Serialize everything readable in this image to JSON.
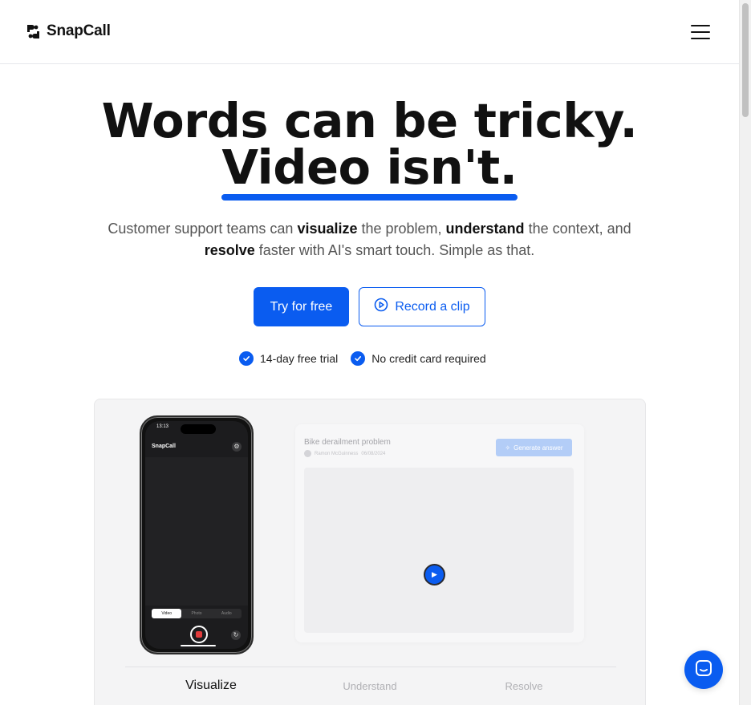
{
  "brand": {
    "name": "SnapCall",
    "accent": "#0a5cf0"
  },
  "hero": {
    "title_line1": "Words can be tricky.",
    "title_line2": "Video isn't.",
    "subtitle": {
      "p1": "Customer support teams can ",
      "b1": "visualize",
      "p2": " the problem, ",
      "b2": "understand",
      "p3": " the context, and ",
      "b3": "resolve",
      "p4": " faster with AI's smart touch. Simple as that."
    }
  },
  "cta": {
    "primary_label": "Try for free",
    "secondary_label": "Record a clip",
    "secondary_icon": "play-circle-icon"
  },
  "checks": [
    {
      "label": "14-day free trial",
      "icon": "check-circle-icon"
    },
    {
      "label": "No credit card required",
      "icon": "check-circle-icon"
    }
  ],
  "demo": {
    "phone": {
      "time": "13:13",
      "logo": "SnapCall",
      "tabs": [
        "Video",
        "Photo",
        "Audio"
      ],
      "active_tab": "Video"
    },
    "card": {
      "title": "Bike derailment problem",
      "author": "Ramon McGuinness",
      "date": "06/08/2024",
      "button_label": "Generate answer"
    },
    "tabs": [
      "Visualize",
      "Understand",
      "Resolve"
    ],
    "active_tab": "Visualize"
  },
  "chat": {
    "icon": "chat-bubble-icon"
  }
}
